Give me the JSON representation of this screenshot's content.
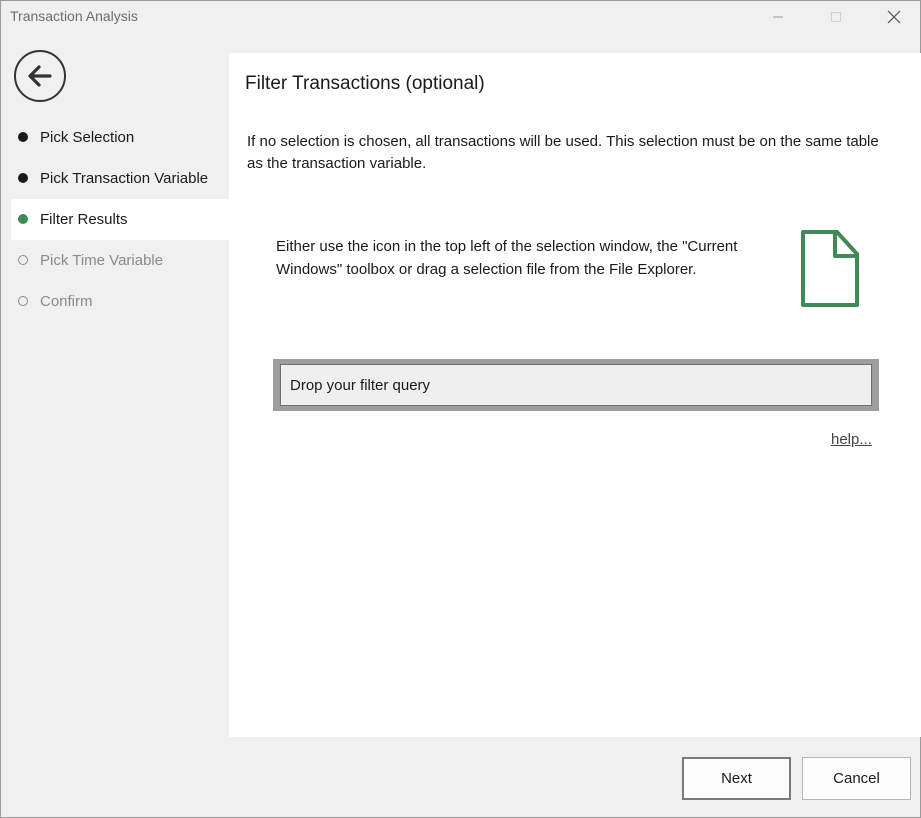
{
  "window": {
    "title": "Transaction Analysis",
    "controls": {
      "minimize_icon": "minimize-icon",
      "maximize_icon": "maximize-icon",
      "close_icon": "close-icon"
    }
  },
  "sidebar": {
    "back_icon": "arrow-left-icon",
    "steps": [
      {
        "label": "Pick Selection",
        "state": "done"
      },
      {
        "label": "Pick Transaction Variable",
        "state": "done"
      },
      {
        "label": "Filter Results",
        "state": "active"
      },
      {
        "label": "Pick Time Variable",
        "state": "pending"
      },
      {
        "label": "Confirm",
        "state": "pending"
      }
    ]
  },
  "main": {
    "title": "Filter Transactions (optional)",
    "description": "If no selection is chosen, all transactions will be used. This selection must be on the same table as the transaction variable.",
    "instructions": "Either use the icon in the top left of the selection window, the \"Current Windows\" toolbox or drag a selection file from the File Explorer.",
    "file_icon": "file-icon",
    "dropzone_text": "Drop your filter query",
    "help_link": "help..."
  },
  "footer": {
    "next_label": "Next",
    "cancel_label": "Cancel"
  },
  "colors": {
    "accent": "#3f8a56",
    "content_bg": "#ffffff",
    "chrome_bg": "#f0f0f0"
  }
}
